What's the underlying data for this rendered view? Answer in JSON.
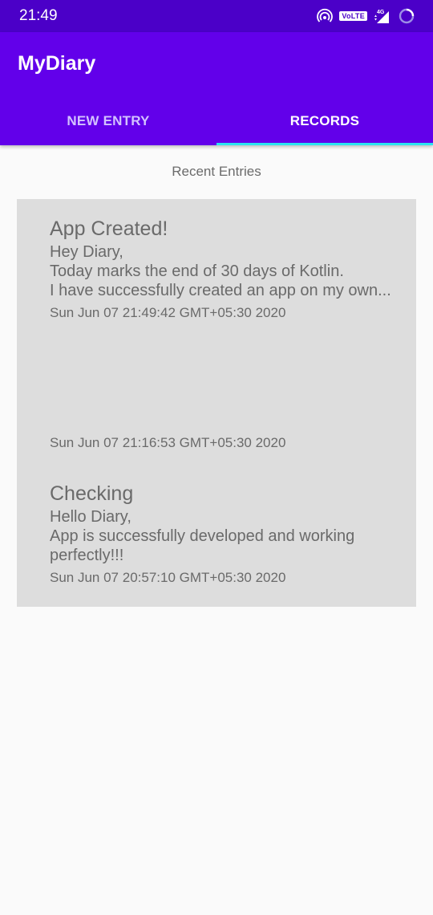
{
  "status_bar": {
    "time": "21:49",
    "volte": "VoLTE",
    "network": "4G",
    "icons": [
      "hotspot-icon",
      "signal-icon",
      "loading-icon"
    ]
  },
  "app": {
    "title": "MyDiary",
    "tabs": [
      {
        "label": "NEW ENTRY",
        "active": false
      },
      {
        "label": "RECORDS",
        "active": true
      }
    ]
  },
  "records": {
    "heading": "Recent Entries",
    "entries": [
      {
        "title": "App Created!",
        "body": "Hey Diary,\nToday marks the end of 30 days of Kotlin.\nI have successfully created an app on my own...",
        "date": "Sun Jun 07 21:49:42 GMT+05:30 2020"
      },
      {
        "title": "",
        "body": "",
        "date": "Sun Jun 07 21:16:53 GMT+05:30 2020"
      },
      {
        "title": "Checking",
        "body": "Hello Diary,\nApp is successfully developed and working perfectly!!!",
        "date": "Sun Jun 07 20:57:10 GMT+05:30 2020"
      }
    ]
  },
  "colors": {
    "status_bar": "#4b00c8",
    "app_bar": "#6200ea",
    "tab_indicator": "#2ce3f0",
    "card": "#dddddd",
    "background": "#fafafa"
  }
}
